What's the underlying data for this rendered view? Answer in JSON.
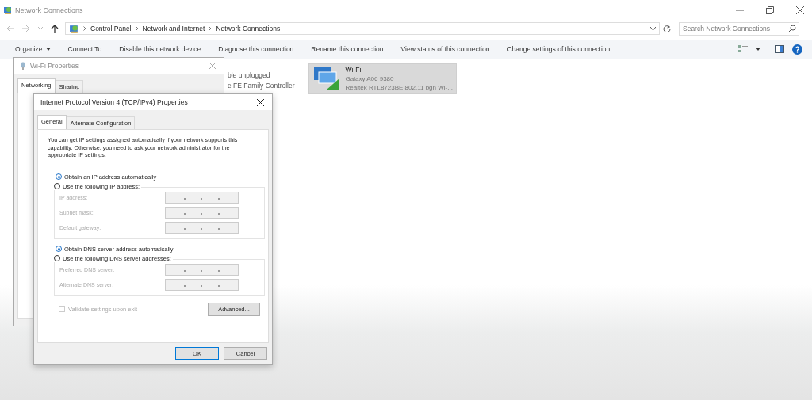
{
  "explorer": {
    "title": "Network Connections",
    "address": {
      "path": [
        "Control Panel",
        "Network and Internet",
        "Network Connections"
      ]
    },
    "search": {
      "placeholder": "Search Network Connections"
    },
    "commands": [
      {
        "label": "Organize",
        "has_menu": true
      },
      {
        "label": "Connect To",
        "has_menu": false
      },
      {
        "label": "Disable this network device",
        "has_menu": false
      },
      {
        "label": "Diagnose this connection",
        "has_menu": false
      },
      {
        "label": "Rename this connection",
        "has_menu": false
      },
      {
        "label": "View status of this connection",
        "has_menu": false
      },
      {
        "label": "Change settings of this connection",
        "has_menu": false
      }
    ],
    "connections": [
      {
        "kind": "ethernet",
        "lines": [
          "ble unplugged",
          "e FE Family Controller"
        ]
      },
      {
        "kind": "wifi",
        "name": "Wi-Fi",
        "lines": [
          "Galaxy A06 9380",
          "Realtek RTL8723BE 802.11 bgn Wi-..."
        ],
        "selected": true
      }
    ]
  },
  "wifi_properties": {
    "title": "Wi-Fi Properties",
    "tabs": [
      {
        "label": "Networking",
        "selected": true
      },
      {
        "label": "Sharing",
        "selected": false
      }
    ]
  },
  "ipv4_properties": {
    "title": "Internet Protocol Version 4 (TCP/IPv4) Properties",
    "tabs": [
      {
        "label": "General",
        "selected": true
      },
      {
        "label": "Alternate Configuration",
        "selected": false
      }
    ],
    "intro": "You can get IP settings assigned automatically if your network supports this capability. Otherwise, you need to ask your network administrator for the appropriate IP settings.",
    "ip_options": [
      {
        "label": "Obtain an IP address automatically",
        "selected": true
      },
      {
        "label": "Use the following IP address:",
        "selected": false
      }
    ],
    "ip_fields": [
      {
        "label": "IP address:",
        "disabled": true
      },
      {
        "label": "Subnet mask:",
        "disabled": true
      },
      {
        "label": "Default gateway:",
        "disabled": true
      }
    ],
    "dns_options": [
      {
        "label": "Obtain DNS server address automatically",
        "selected": true
      },
      {
        "label": "Use the following DNS server addresses:",
        "selected": false
      }
    ],
    "dns_fields": [
      {
        "label": "Preferred DNS server:",
        "disabled": true
      },
      {
        "label": "Alternate DNS server:",
        "disabled": true
      }
    ],
    "validate": {
      "label": "Validate settings upon exit",
      "checked": false,
      "disabled": true
    },
    "advanced_button": "Advanced...",
    "buttons": [
      {
        "label": "OK",
        "default": true
      },
      {
        "label": "Cancel",
        "default": false
      }
    ]
  }
}
